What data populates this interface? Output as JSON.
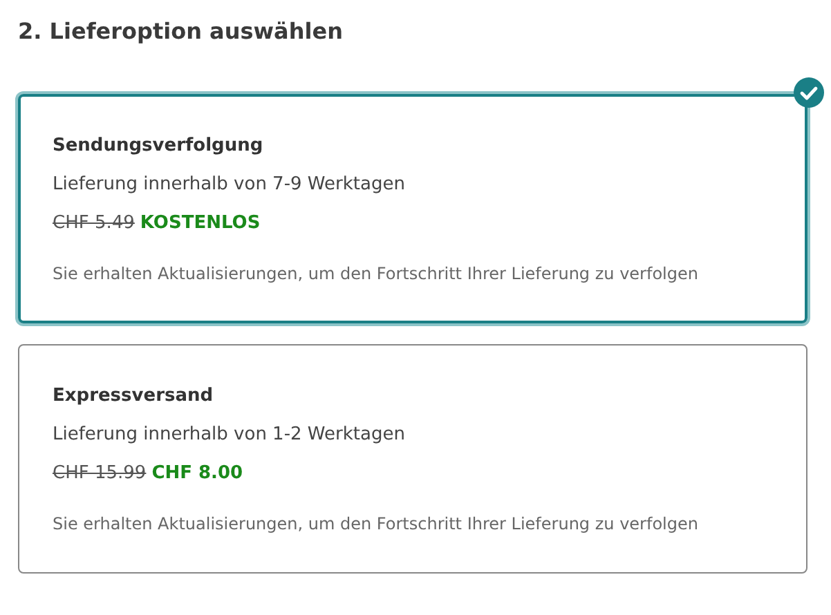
{
  "heading": "2. Lieferoption auswählen",
  "options": [
    {
      "name": "Sendungsverfolgung",
      "delivery": "Lieferung innerhalb von 7-9 Werktagen",
      "old_price": "CHF 5.49",
      "price": "KOSTENLOS",
      "note": "Sie erhalten Aktualisierungen, um den Fortschritt Ihrer Lieferung zu verfolgen",
      "selected": true
    },
    {
      "name": "Expressversand",
      "delivery": "Lieferung innerhalb von 1-2 Werktagen",
      "old_price": "CHF 15.99",
      "price": "CHF 8.00",
      "note": "Sie erhalten Aktualisierungen, um den Fortschritt Ihrer Lieferung zu verfolgen",
      "selected": false
    }
  ]
}
